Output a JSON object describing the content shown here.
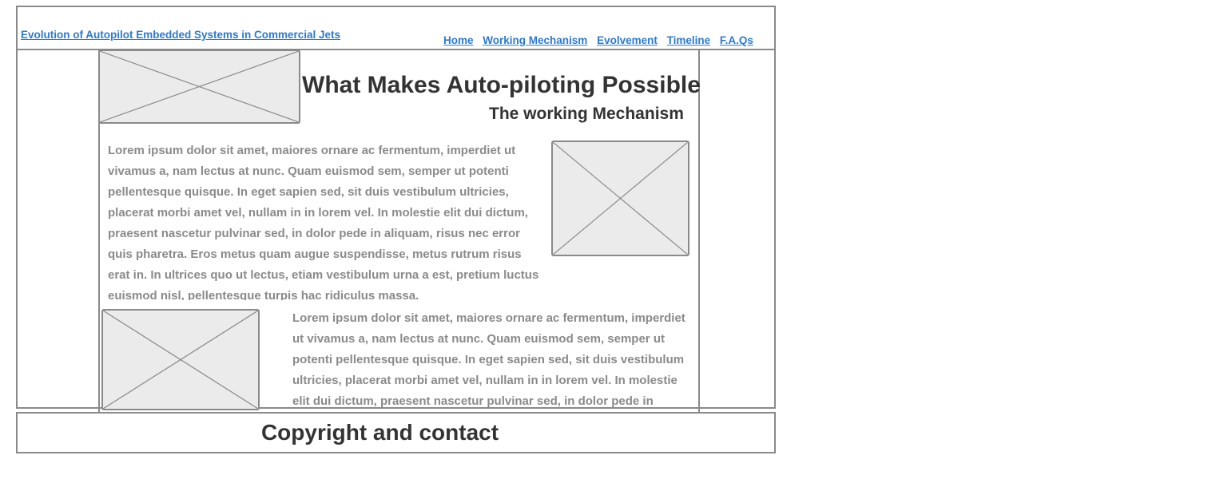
{
  "header": {
    "site_title": "Evolution of Autopilot Embedded Systems in Commercial Jets",
    "nav": [
      "Home",
      "Working Mechanism",
      "Evolvement",
      "Timeline",
      "F.A.Qs"
    ]
  },
  "main": {
    "heading": "What Makes Auto-piloting Possible",
    "subheading": "The working Mechanism",
    "paragraph_1": "Lorem ipsum dolor sit amet, maiores ornare ac fermentum, imperdiet ut vivamus a, nam lectus at nunc. Quam euismod sem, semper ut potenti pellentesque quisque. In eget sapien sed, sit duis vestibulum ultricies, placerat morbi amet vel, nullam in in lorem vel. In molestie elit dui dictum, praesent nascetur pulvinar sed, in dolor pede in aliquam, risus nec error quis pharetra. Eros metus quam augue suspendisse, metus rutrum risus erat in.  In ultrices quo ut lectus, etiam vestibulum urna a est, pretium luctus euismod nisl, pellentesque turpis hac ridiculus massa.",
    "paragraph_2": "Lorem ipsum dolor sit amet, maiores ornare ac fermentum, imperdiet ut vivamus a, nam lectus at nunc. Quam euismod sem, semper ut potenti pellentesque quisque. In eget sapien sed, sit duis vestibulum ultricies, placerat morbi amet vel, nullam in in lorem vel. In molestie elit dui dictum, praesent nascetur pulvinar sed, in dolor pede in aliquam, risus nec error quis pharetra."
  },
  "footer": {
    "text": "Copyright and contact"
  },
  "colors": {
    "link": "#2a7ad2",
    "border": "#8a8a8a",
    "placeholder_fill": "#ebebeb",
    "heading": "#333333",
    "body_text": "#8a8a8a"
  },
  "icons": {
    "image_placeholder": "image-placeholder-icon"
  }
}
